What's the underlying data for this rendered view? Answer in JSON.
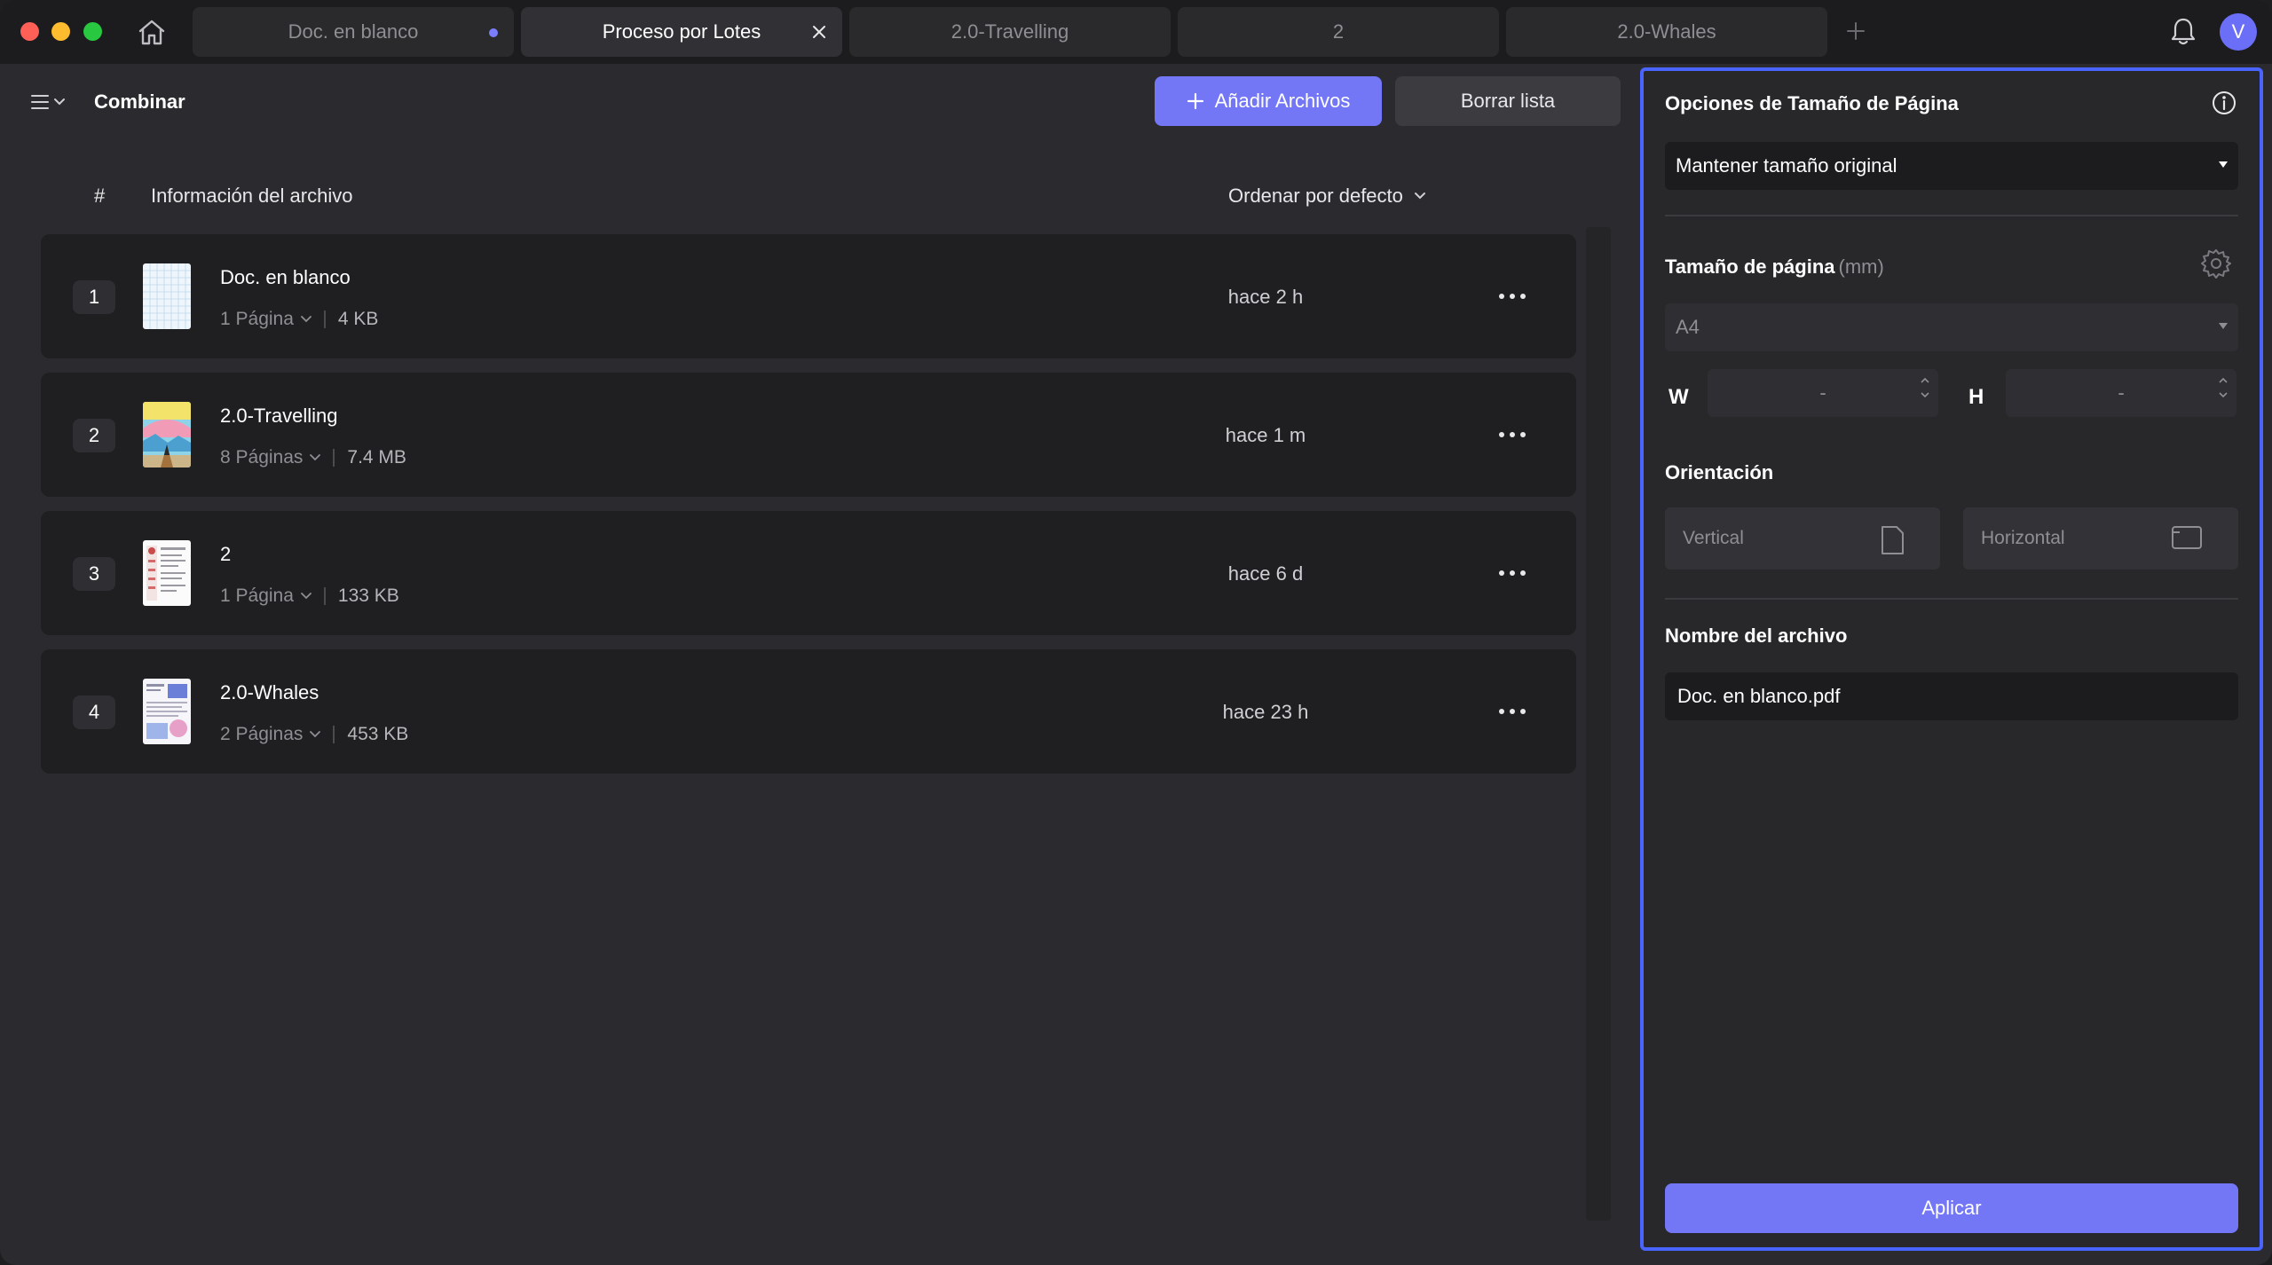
{
  "tabs": [
    {
      "label": "Doc. en blanco",
      "active": false,
      "unsaved": true
    },
    {
      "label": "Proceso por Lotes",
      "active": true
    },
    {
      "label": "2.0-Travelling",
      "active": false
    },
    {
      "label": "2",
      "active": false
    },
    {
      "label": "2.0-Whales",
      "active": false
    }
  ],
  "user": {
    "initial": "V"
  },
  "toolbar": {
    "title": "Combinar",
    "add_label": "Añadir Archivos",
    "clear_label": "Borrar lista"
  },
  "list": {
    "col_hash": "#",
    "col_info": "Información del archivo",
    "sort_label": "Ordenar por defecto",
    "files": [
      {
        "num": "1",
        "name": "Doc. en blanco",
        "pages": "1 Página",
        "size": "4 KB",
        "time": "hace 2 h"
      },
      {
        "num": "2",
        "name": "2.0-Travelling",
        "pages": "8 Páginas",
        "size": "7.4 MB",
        "time": "hace 1 m"
      },
      {
        "num": "3",
        "name": "2",
        "pages": "1 Página",
        "size": "133 KB",
        "time": "hace 6 d"
      },
      {
        "num": "4",
        "name": "2.0-Whales",
        "pages": "2 Páginas",
        "size": "453 KB",
        "time": "hace 23 h"
      }
    ]
  },
  "panel": {
    "title": "Opciones de Tamaño de Página",
    "size_option": "Mantener tamaño original",
    "page_size_label": "Tamaño de página",
    "page_size_unit": "(mm)",
    "page_size_value": "A4",
    "w_label": "W",
    "h_label": "H",
    "w_value": "-",
    "h_value": "-",
    "orientation_label": "Orientación",
    "vertical_label": "Vertical",
    "horizontal_label": "Horizontal",
    "filename_label": "Nombre del archivo",
    "filename_value": "Doc. en blanco.pdf",
    "apply_label": "Aplicar"
  },
  "colors": {
    "accent": "#7377f6",
    "panel_border": "#4a64ff",
    "background": "#2b2b2f",
    "row_background": "#1f1f22"
  }
}
